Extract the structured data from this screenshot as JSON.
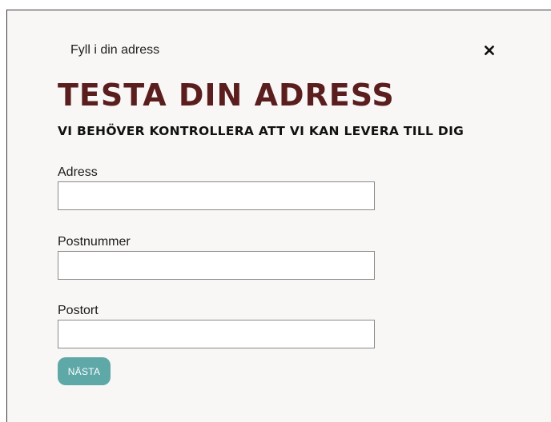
{
  "modal": {
    "heading": "Fyll i din adress",
    "close_icon": "close-icon"
  },
  "title": "TESTA DIN ADRESS",
  "subtitle": "VI BEHÖVER KONTROLLERA ATT VI KAN LEVERA TILL DIG",
  "form": {
    "address": {
      "label": "Adress",
      "value": "",
      "placeholder": ""
    },
    "postal_code": {
      "label": "Postnummer",
      "value": "",
      "placeholder": ""
    },
    "city": {
      "label": "Postort",
      "value": "",
      "placeholder": ""
    },
    "next_label": "NÄSTA"
  },
  "colors": {
    "title": "#5a1e1e",
    "button": "#5fa8a8",
    "modal_background": "#f8f7f5"
  }
}
